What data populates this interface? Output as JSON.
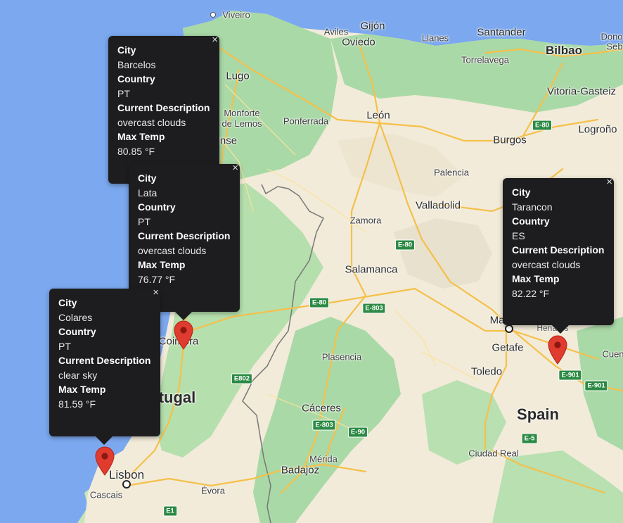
{
  "map": {
    "places": [
      {
        "id": "viveiro",
        "label": "Viveiro"
      },
      {
        "id": "aviles",
        "label": "Aviles"
      },
      {
        "id": "gijon",
        "label": "Gijón"
      },
      {
        "id": "oviedo",
        "label": "Oviedo"
      },
      {
        "id": "llanes",
        "label": "Llanes"
      },
      {
        "id": "santander",
        "label": "Santander"
      },
      {
        "id": "torrelavega",
        "label": "Torrelavega"
      },
      {
        "id": "bilbao",
        "label": "Bilbao"
      },
      {
        "id": "dono",
        "label": "Dono"
      },
      {
        "id": "seb",
        "label": "Seb"
      },
      {
        "id": "vitoria",
        "label": "Vitoria-Gasteiz"
      },
      {
        "id": "lugo",
        "label": "Lugo"
      },
      {
        "id": "monforte",
        "label": "Monforte\nde Lemos"
      },
      {
        "id": "ponferrada",
        "label": "Ponferrada"
      },
      {
        "id": "leon",
        "label": "León"
      },
      {
        "id": "logrono",
        "label": "Logroño"
      },
      {
        "id": "burgos",
        "label": "Burgos"
      },
      {
        "id": "ourense",
        "label": "nse"
      },
      {
        "id": "palencia",
        "label": "Palencia"
      },
      {
        "id": "valladolid",
        "label": "Valladolid"
      },
      {
        "id": "zamora",
        "label": "Zamora"
      },
      {
        "id": "salamanca",
        "label": "Salamanca"
      },
      {
        "id": "madrid",
        "label": "Ma"
      },
      {
        "id": "getafe",
        "label": "Getafe"
      },
      {
        "id": "toledo",
        "label": "Toledo"
      },
      {
        "id": "plasencia",
        "label": "Plasencia"
      },
      {
        "id": "caceres",
        "label": "Cáceres"
      },
      {
        "id": "merida",
        "label": "Mérida"
      },
      {
        "id": "badajoz",
        "label": "Badajoz"
      },
      {
        "id": "ciudadreal",
        "label": "Ciudad Real"
      },
      {
        "id": "cuen",
        "label": "Cuen"
      },
      {
        "id": "henares",
        "label": "Henares"
      },
      {
        "id": "coimbra",
        "label": "Coimbra"
      },
      {
        "id": "lisbon",
        "label": "Lisbon"
      },
      {
        "id": "cascais",
        "label": "Cascais"
      },
      {
        "id": "evora",
        "label": "Évora"
      },
      {
        "id": "portugal",
        "label": "tugal"
      },
      {
        "id": "spain",
        "label": "Spain"
      }
    ],
    "shields": [
      "E-80",
      "E-80",
      "E-80",
      "E-803",
      "E802",
      "E-803",
      "E-90",
      "E-901",
      "E-901",
      "E-5",
      "E1"
    ]
  },
  "infowindows": [
    {
      "name": "barcelos-infowindow",
      "rows": [
        {
          "k": "City",
          "v": "Barcelos"
        },
        {
          "k": "Country",
          "v": "PT"
        },
        {
          "k": "Current Description",
          "v": "overcast clouds"
        },
        {
          "k": "Max Temp",
          "v": "80.85 °F"
        }
      ]
    },
    {
      "name": "lata-infowindow",
      "rows": [
        {
          "k": "City",
          "v": "Lata"
        },
        {
          "k": "Country",
          "v": "PT"
        },
        {
          "k": "Current Description",
          "v": "overcast clouds"
        },
        {
          "k": "Max Temp",
          "v": "76.77 °F"
        }
      ]
    },
    {
      "name": "colares-infowindow",
      "rows": [
        {
          "k": "City",
          "v": "Colares"
        },
        {
          "k": "Country",
          "v": "PT"
        },
        {
          "k": "Current Description",
          "v": "clear sky"
        },
        {
          "k": "Max Temp",
          "v": "81.59 °F"
        }
      ]
    },
    {
      "name": "tarancon-infowindow",
      "rows": [
        {
          "k": "City",
          "v": "Tarancon"
        },
        {
          "k": "Country",
          "v": "ES"
        },
        {
          "k": "Current Description",
          "v": "overcast clouds"
        },
        {
          "k": "Max Temp",
          "v": "82.22 °F"
        }
      ]
    }
  ],
  "close_glyph": "×",
  "colors": {
    "water": "#7ba8ef",
    "land_green": "#a3d7a4",
    "land_tan": "#f3ecdc",
    "road": "#f5c04a",
    "marker": "#e03b2f",
    "infowindow_bg": "#1d1d1f"
  }
}
